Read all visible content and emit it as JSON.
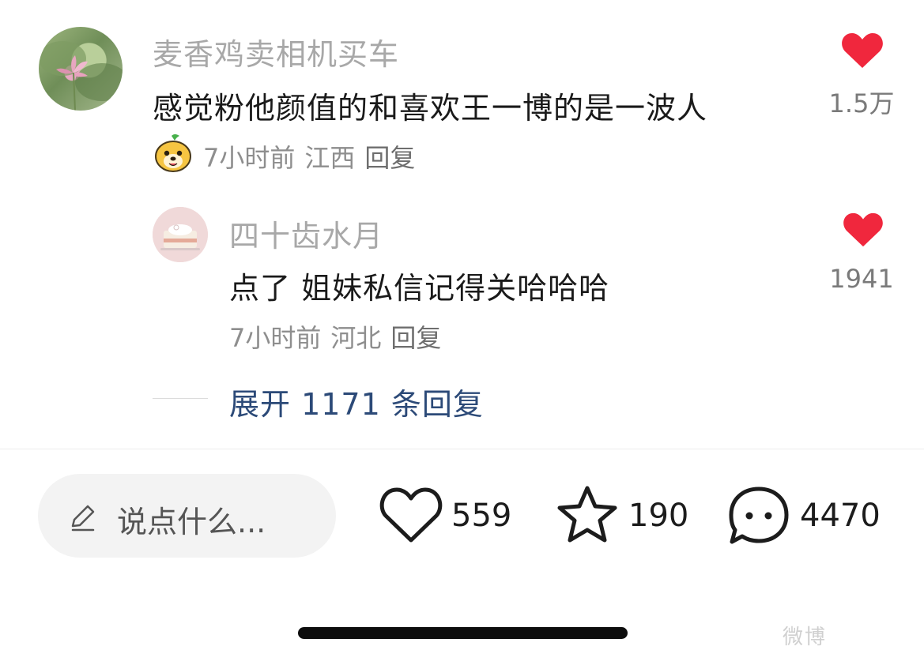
{
  "colors": {
    "like_heart": "#f0273d",
    "link_blue": "#2c4a78",
    "username_gray": "#a8a8a8",
    "meta_gray": "#8e8e8e"
  },
  "comment": {
    "username": "麦香鸡卖相机买车",
    "text": "感觉粉他颜值的和喜欢王一博的是一波人",
    "badge_icon": "puppy-sticker-icon",
    "time": "7小时前",
    "location": "江西",
    "reply_label": "回复",
    "like_count": "1.5万"
  },
  "reply": {
    "username": "四十齿水月",
    "text": "点了 姐妹私信记得关哈哈哈",
    "time": "7小时前",
    "location": "河北",
    "reply_label": "回复",
    "like_count": "1941"
  },
  "expand": {
    "label": "展开 1171 条回复"
  },
  "bottom_bar": {
    "input_placeholder": "说点什么...",
    "likes": "559",
    "favorites": "190",
    "comments": "4470"
  },
  "watermark": "微博"
}
